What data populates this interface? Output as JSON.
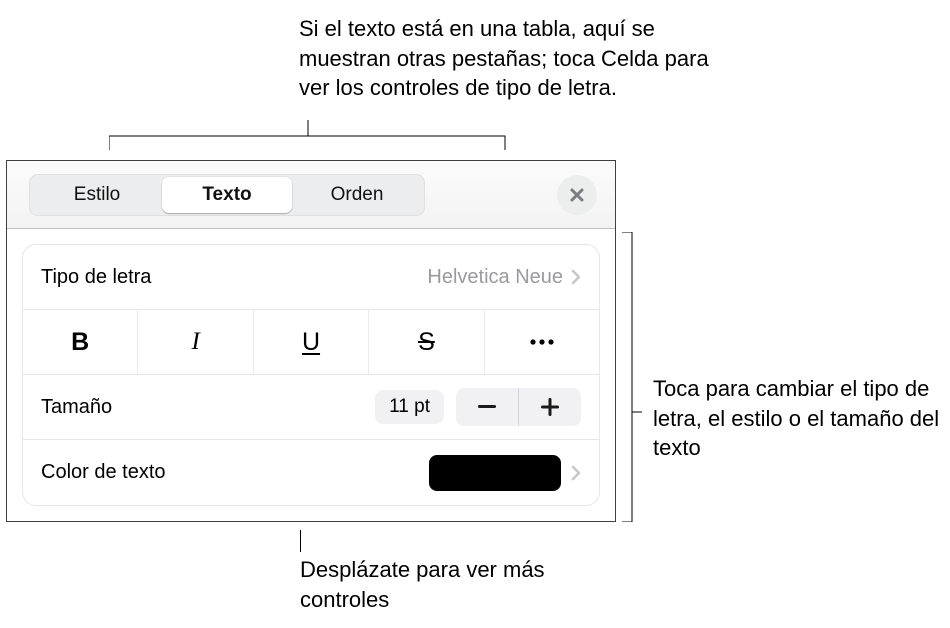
{
  "callouts": {
    "top": "Si el texto está en una tabla, aquí se muestran otras pestañas; toca Celda para ver los controles de tipo de letra.",
    "right": "Toca para cambiar el tipo de letra, el estilo o el tamaño del texto",
    "bottom": "Desplázate para ver más controles"
  },
  "tabs": {
    "style": "Estilo",
    "text": "Texto",
    "order": "Orden"
  },
  "rows": {
    "font_label": "Tipo de letra",
    "font_value": "Helvetica Neue",
    "size_label": "Tamaño",
    "size_value": "11 pt",
    "color_label": "Color de texto"
  },
  "color_value": "#000000"
}
